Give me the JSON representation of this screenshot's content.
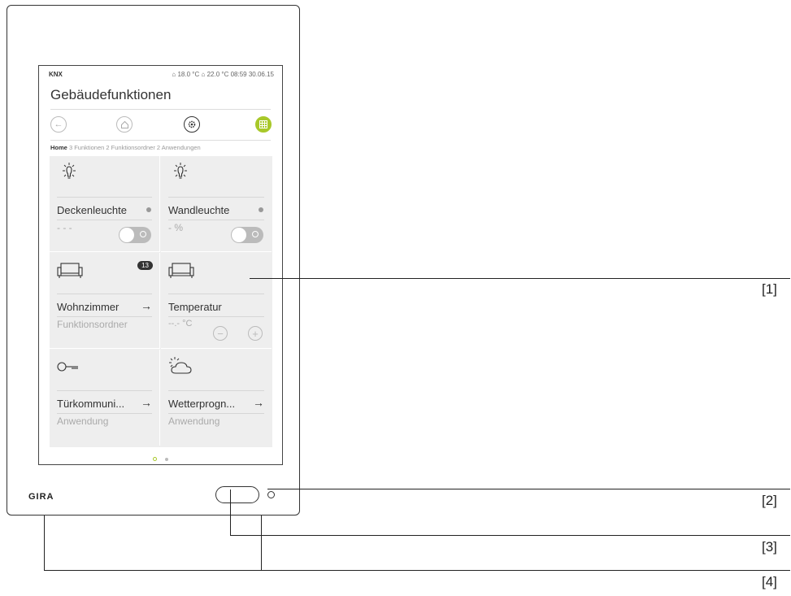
{
  "status_bar": {
    "brand": "KNX",
    "outdoor_temp": "18.0 °C",
    "indoor_temp": "22.0 °C",
    "time": "08:59",
    "date": "30.06.15"
  },
  "page_title": "Gebäudefunktionen",
  "breadcrumb": {
    "home": "Home",
    "rest": "3 Funktionen 2 Funktionsordner 2 Anwendungen"
  },
  "tiles": [
    {
      "name": "Deckenleuchte",
      "sub": "- - -",
      "icon": "bulb-icon"
    },
    {
      "name": "Wandleuchte",
      "sub": "- %",
      "icon": "bulb-icon"
    },
    {
      "name": "Wohnzimmer",
      "sub": "Funktionsordner",
      "icon": "sofa-icon",
      "badge": "13",
      "arrow": "→"
    },
    {
      "name": "Temperatur",
      "sub": "--.- °C",
      "icon": "sofa-icon",
      "minus": "−",
      "plus": "+"
    },
    {
      "name": "Türkommuni...",
      "sub": "Anwendung",
      "icon": "key-icon",
      "arrow": "→"
    },
    {
      "name": "Wetterprogn...",
      "sub": "Anwendung",
      "icon": "weather-icon",
      "arrow": "→"
    }
  ],
  "device_brand": "GIRA",
  "callouts": [
    "[1]",
    "[2]",
    "[3]",
    "[4]"
  ],
  "colors": {
    "accent": "#a8c82a"
  }
}
